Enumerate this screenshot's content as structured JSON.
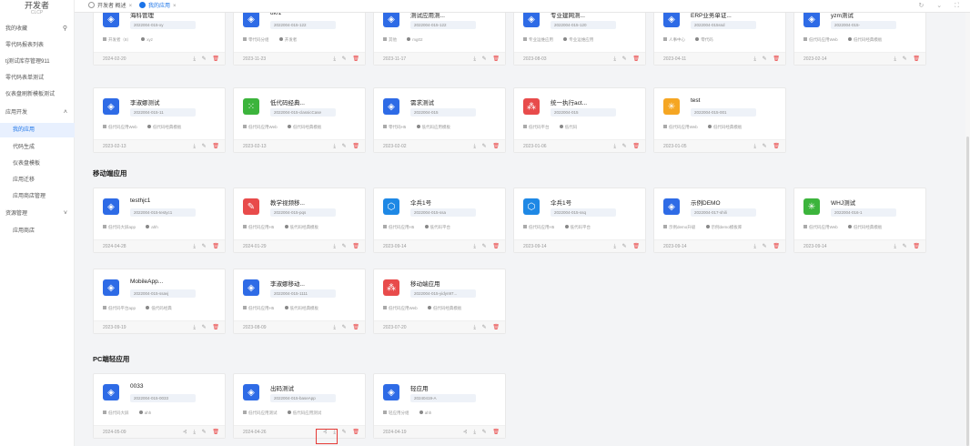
{
  "brand": {
    "title": "开发者",
    "subtitle": "CLCP"
  },
  "sidebar": {
    "items": [
      {
        "label": "我的收藏",
        "icon": "search-icon"
      },
      {
        "label": "零代码报表列表"
      },
      {
        "label": "tj测试库存管理911"
      },
      {
        "label": "零代码表单测试"
      },
      {
        "label": "仪表盘刷新模板测试"
      },
      {
        "label": "应用开发",
        "arrow": "˄"
      },
      {
        "label": "我的应用",
        "active": true
      },
      {
        "label": "代码生成"
      },
      {
        "label": "仪表盘模板"
      },
      {
        "label": "应用迁移"
      },
      {
        "label": "应用商店管理"
      },
      {
        "label": "资源管理",
        "arrow": "˅"
      },
      {
        "label": "应用商店"
      }
    ]
  },
  "tabs": [
    {
      "label": "开发者 概述",
      "close": "×"
    },
    {
      "label": "我的应用",
      "close": "×"
    }
  ],
  "top_icons": "↻ ⌄ ⛶",
  "sections": [
    {
      "title": "移动端应用"
    },
    {
      "title": "PC端轻应用"
    }
  ],
  "actions": {
    "download": "⤓",
    "edit": "✎",
    "delete": "🗑",
    "share": "⊰"
  },
  "icon_colors": {
    "blue": "#2e6be6",
    "green": "#3cb43c",
    "red": "#e84b4b",
    "orange": "#f5a623",
    "lightblue": "#1e88e5"
  },
  "cards": [
    {
      "name": "海科管理",
      "code": "2022004-015-xy",
      "tags": [
        "开发者（8）",
        "xyz"
      ],
      "date": "2024-02-20",
      "icon": "layers-icon",
      "color": "blue"
    },
    {
      "name": "ui01",
      "code": "2022004-015-122",
      "tags": [
        "零代码分组",
        "开发者"
      ],
      "date": "2023-11-23",
      "icon": "layers-icon",
      "color": "blue"
    },
    {
      "name": "测试应用测...",
      "code": "2022004-015-122",
      "tags": [
        "其他",
        "mg02"
      ],
      "date": "2023-11-17",
      "icon": "layers-icon",
      "color": "blue"
    },
    {
      "name": "专业建网测...",
      "code": "2022004-015-120",
      "tags": [
        "专业运维应用",
        "专业运维应用"
      ],
      "date": "2023-08-03",
      "icon": "layers-icon",
      "color": "blue"
    },
    {
      "name": "ERP业务单证...",
      "code": "2022004-015ssd",
      "tags": [
        "人事中心",
        "零代码"
      ],
      "date": "2023-04-11",
      "icon": "layers-icon",
      "color": "blue"
    },
    {
      "name": "yzm测试",
      "code": "2022004-015-",
      "tags": [
        "低代码应用Web",
        "低代码经典模板"
      ],
      "date": "2023-02-14",
      "icon": "layers-icon",
      "color": "blue"
    },
    {
      "name": "李淑娜测试",
      "code": "2022004-015-11",
      "tags": [
        "低代码应用Web",
        "低代码经典模板"
      ],
      "date": "2023-02-13",
      "icon": "layers-icon",
      "color": "blue"
    },
    {
      "name": "低代码经典...",
      "code": "2022004-015-classicCase",
      "tags": [
        "低代码应用Web",
        "低代码经典模板"
      ],
      "date": "2023-02-13",
      "icon": "grid-icon",
      "color": "green"
    },
    {
      "name": "需求测试",
      "code": "2022004-015",
      "tags": [
        "零代码H5",
        "低代码应用模板"
      ],
      "date": "2023-02-02",
      "icon": "layers-icon",
      "color": "blue"
    },
    {
      "name": "统一执行act...",
      "code": "2022004-015",
      "tags": [
        "低代码平台",
        "低代码"
      ],
      "date": "2023-01-06",
      "icon": "dots-icon",
      "color": "red"
    },
    {
      "name": "test",
      "code": "2022004-015-001",
      "tags": [
        "低代码应用Web",
        "低代码经典模板"
      ],
      "date": "2023-01-05",
      "icon": "spark-icon",
      "color": "orange"
    },
    {
      "name": "testhjc1",
      "code": "2022004-015-testyc1",
      "tags": [
        "低代码大屏app",
        "ahh"
      ],
      "date": "2024-04-28",
      "icon": "layers-icon",
      "color": "blue"
    },
    {
      "name": "教学视频移...",
      "code": "2022004-015-pqs",
      "tags": [
        "低代码应用H5",
        "低代码经典模板"
      ],
      "date": "2024-01-29",
      "icon": "pen-icon",
      "color": "red"
    },
    {
      "name": "伞兵1号",
      "code": "2022004-015-ssa",
      "tags": [
        "低代码应用H5",
        "低代码平台"
      ],
      "date": "2023-09-14",
      "icon": "cube-icon",
      "color": "lightblue"
    },
    {
      "name": "伞兵1号",
      "code": "2022004-015-ssq",
      "tags": [
        "低代码应用H5",
        "低代码平台"
      ],
      "date": "2023-09-14",
      "icon": "cube-icon",
      "color": "lightblue"
    },
    {
      "name": "示例DEMO",
      "code": "2022004-017-shili",
      "tags": [
        "示例demo升级",
        "示例demo模板库"
      ],
      "date": "2023-09-14",
      "icon": "layers-icon",
      "color": "blue"
    },
    {
      "name": "WHJ测试",
      "code": "2022004-016-1",
      "tags": [
        "低代码应用Web",
        "低代码经典模板"
      ],
      "date": "2023-09-14",
      "icon": "spark-icon",
      "color": "green"
    },
    {
      "name": "MobileApp...",
      "code": "2022004-015-ssavj",
      "tags": [
        "低代码平台app",
        "低代码经典"
      ],
      "date": "2023-09-19",
      "icon": "layers-icon",
      "color": "blue"
    },
    {
      "name": "李淑娜移动...",
      "code": "2022004-015-1111",
      "tags": [
        "低代码应用H5",
        "低代码经典模板"
      ],
      "date": "2023-08-09",
      "icon": "layers-icon",
      "color": "blue"
    },
    {
      "name": "移动端应用",
      "code": "2022004-015-yidyn97...",
      "tags": [
        "低代码应用Web",
        "低代码经典模板"
      ],
      "date": "2023-07-20",
      "icon": "dots-icon",
      "color": "red"
    },
    {
      "name": "0033",
      "code": "2022004-015-0033",
      "tags": [
        "低代码大屏",
        "ahh"
      ],
      "date": "2024-05-09",
      "icon": "layers-icon",
      "color": "blue"
    },
    {
      "name": "出码测试",
      "code": "2022004-015-baseApp",
      "tags": [
        "低代码应用测试",
        "低代码应用测试"
      ],
      "date": "2024-04-26",
      "icon": "layers-icon",
      "color": "blue"
    },
    {
      "name": "轻应用",
      "code": "20240419-A",
      "tags": [
        "轻应用分组",
        "ahh"
      ],
      "date": "2024-04-19",
      "icon": "layers-icon",
      "color": "blue"
    }
  ]
}
